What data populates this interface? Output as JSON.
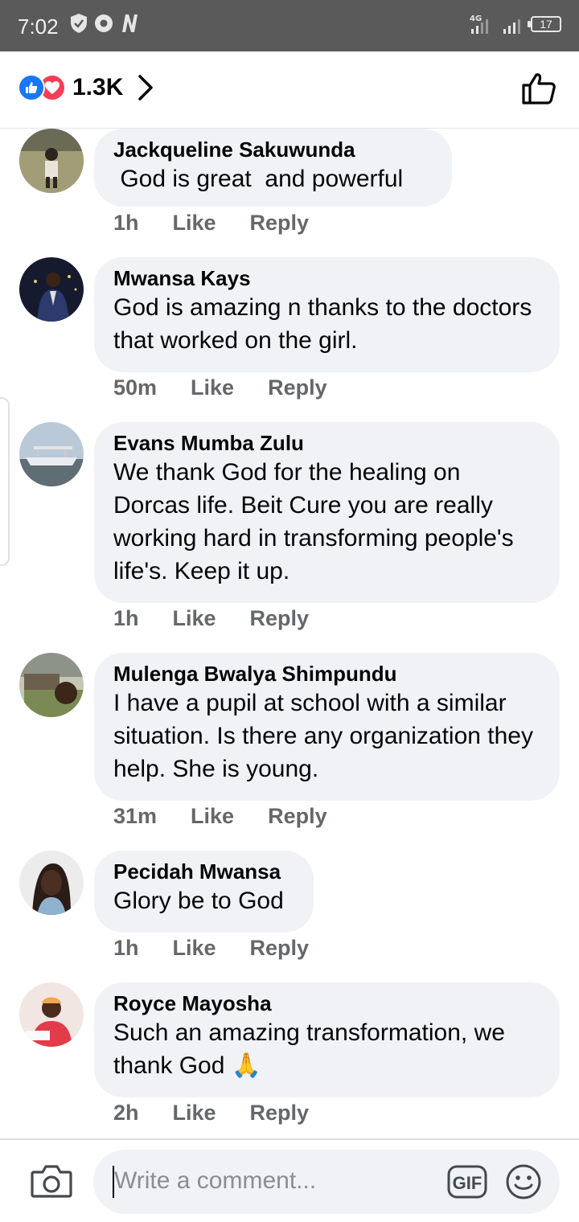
{
  "status_bar": {
    "time": "7:02",
    "network": "4G",
    "battery": "17"
  },
  "header": {
    "reaction_count": "1.3K"
  },
  "comments": [
    {
      "author": "Jackqueline Sakuwunda",
      "text": " God is great  and powerful",
      "time": "1h",
      "like": "Like",
      "reply": "Reply"
    },
    {
      "author": "Mwansa Kays",
      "text": "God is amazing n thanks to the doctors that worked on the girl.",
      "time": "50m",
      "like": "Like",
      "reply": "Reply"
    },
    {
      "author": "Evans Mumba Zulu",
      "text": "We thank God for the healing on Dorcas life. Beit Cure you are really working hard in transforming people's life's. Keep it up.",
      "time": "1h",
      "like": "Like",
      "reply": "Reply"
    },
    {
      "author": "Mulenga Bwalya Shimpundu",
      "text": "I have a pupil at school with a similar situation. Is there any organization they help. She is young.",
      "time": "31m",
      "like": "Like",
      "reply": "Reply"
    },
    {
      "author": "Pecidah Mwansa",
      "text": "Glory be to God",
      "time": "1h",
      "like": "Like",
      "reply": "Reply"
    },
    {
      "author": "Royce Mayosha",
      "text": "Such an amazing transformation, we thank God 🙏",
      "time": "2h",
      "like": "Like",
      "reply": "Reply"
    }
  ],
  "composer": {
    "placeholder": "Write a comment...",
    "gif_label": "GIF"
  },
  "icons": {
    "like": "like-reaction-icon",
    "love": "love-reaction-icon",
    "chevron": "chevron-right-icon",
    "thumbs_up": "thumbs-up-icon",
    "camera": "camera-icon",
    "emoji": "emoji-icon"
  },
  "colors": {
    "like_blue": "#1877f2",
    "love_red": "#f33e58",
    "bubble": "#f0f2f5",
    "meta_gray": "#65676b"
  }
}
